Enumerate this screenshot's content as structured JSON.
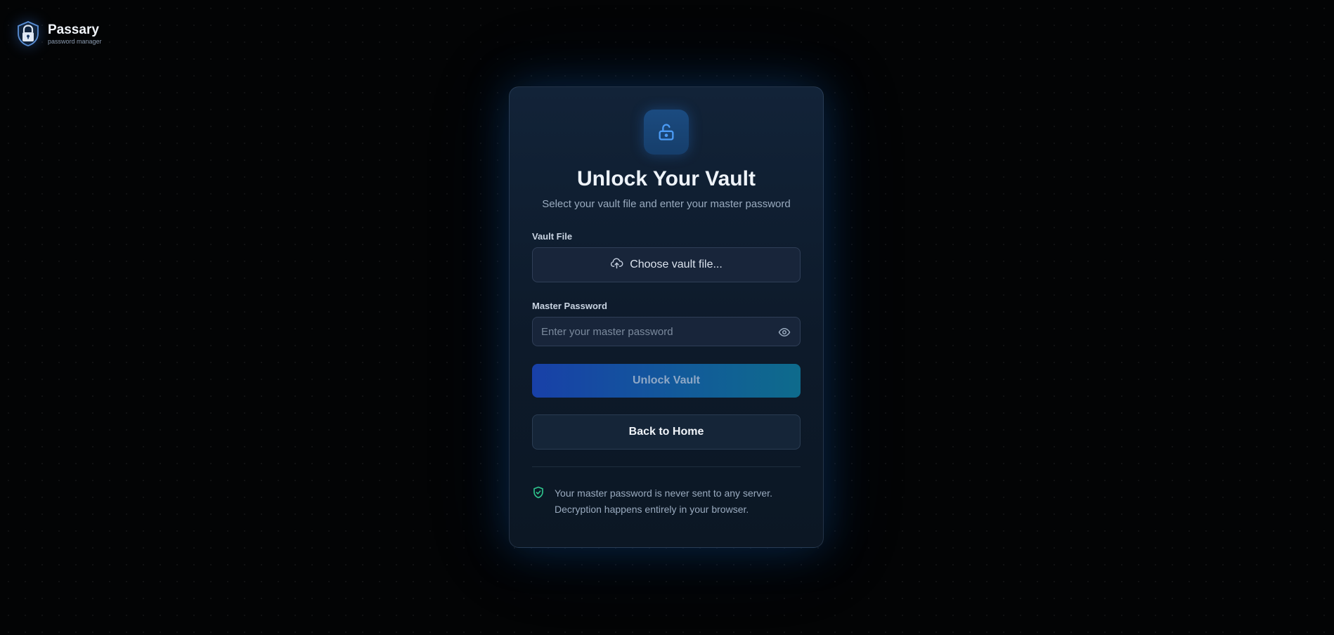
{
  "brand": {
    "name": "Passary",
    "tagline": "password manager",
    "icon": "shield-lock-icon"
  },
  "card": {
    "icon": "unlock-icon",
    "title": "Unlock Your Vault",
    "subtitle": "Select your vault file and enter your master password",
    "vault_file": {
      "label": "Vault File",
      "button_label": "Choose vault file...",
      "icon": "cloud-upload-icon"
    },
    "master_password": {
      "label": "Master Password",
      "placeholder": "Enter your master password",
      "value": "",
      "toggle_icon": "eye-icon"
    },
    "unlock_button": "Unlock Vault",
    "back_button": "Back to Home",
    "notice": {
      "icon": "shield-check-icon",
      "line1": "Your master password is never sent to any server.",
      "line2": "Decryption happens entirely in your browser."
    }
  },
  "colors": {
    "background": "#030405",
    "card": "#0f1e30",
    "accent_blue": "#1840a8",
    "accent_teal": "#0e6b8c",
    "success_green": "#2fc48d",
    "icon_blue": "#3b8cf0"
  }
}
